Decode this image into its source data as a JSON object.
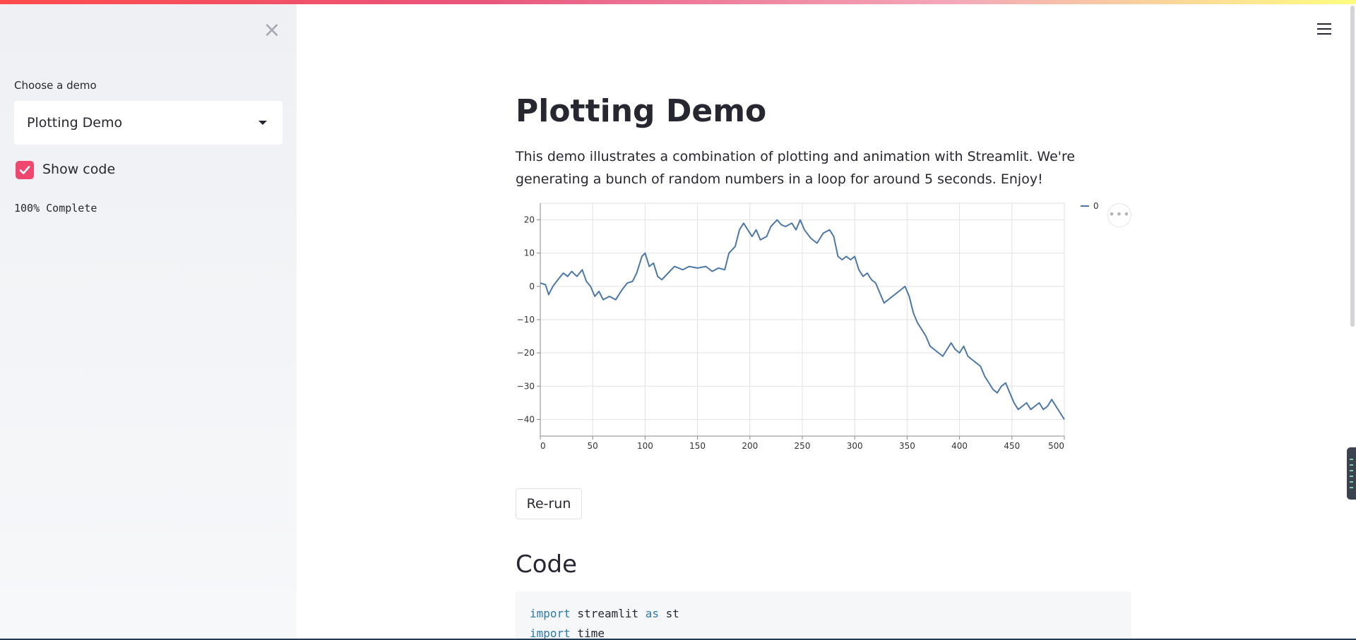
{
  "sidebar": {
    "close_symbol": "×",
    "select_label": "Choose a demo",
    "select_value": "Plotting Demo",
    "checkbox_label": "Show code",
    "checkbox_checked": true,
    "progress_text": "100% Complete",
    "progress_percent": 100,
    "checkbox_color": "#f0476e"
  },
  "header": {
    "menu_icon": "hamburger-menu-icon"
  },
  "main": {
    "title": "Plotting Demo",
    "description": "This demo illustrates a combination of plotting and animation with Streamlit. We're generating a bunch of random numbers in a loop for around 5 seconds. Enjoy!",
    "chart_menu_symbol": "•••",
    "rerun_label": "Re-run",
    "code_heading": "Code",
    "code_lines": [
      [
        {
          "t": "import",
          "kw": true
        },
        {
          "t": " streamlit ",
          "kw": false
        },
        {
          "t": "as",
          "kw": true
        },
        {
          "t": " st",
          "kw": false
        }
      ],
      [
        {
          "t": "import",
          "kw": true
        },
        {
          "t": " time",
          "kw": false
        }
      ]
    ]
  },
  "colors": {
    "accent": "#f0476e",
    "line": "#4c78a8",
    "keyword": "#2b7aa8"
  },
  "chart_data": {
    "type": "line",
    "xlim": [
      0,
      500
    ],
    "ylim": [
      -45,
      25
    ],
    "x_ticks": [
      0,
      50,
      100,
      150,
      200,
      250,
      300,
      350,
      400,
      450,
      500
    ],
    "y_ticks": [
      20,
      10,
      0,
      -10,
      -20,
      -30,
      -40
    ],
    "grid": true,
    "legend_position": "top-right",
    "series": [
      {
        "name": "0",
        "color": "#4c78a8",
        "points": [
          [
            0,
            1
          ],
          [
            5,
            0.5
          ],
          [
            8,
            -2.5
          ],
          [
            12,
            0
          ],
          [
            18,
            2.5
          ],
          [
            22,
            4
          ],
          [
            26,
            3
          ],
          [
            30,
            4.5
          ],
          [
            35,
            3
          ],
          [
            40,
            5
          ],
          [
            44,
            1.5
          ],
          [
            48,
            0
          ],
          [
            52,
            -3
          ],
          [
            56,
            -1.5
          ],
          [
            60,
            -4
          ],
          [
            66,
            -3
          ],
          [
            72,
            -4
          ],
          [
            78,
            -1
          ],
          [
            83,
            1
          ],
          [
            88,
            1.5
          ],
          [
            92,
            4
          ],
          [
            97,
            9
          ],
          [
            100,
            10
          ],
          [
            104,
            6
          ],
          [
            108,
            7
          ],
          [
            112,
            3
          ],
          [
            116,
            2
          ],
          [
            122,
            4
          ],
          [
            128,
            6
          ],
          [
            136,
            5
          ],
          [
            142,
            6
          ],
          [
            150,
            5.5
          ],
          [
            158,
            6
          ],
          [
            164,
            4.5
          ],
          [
            170,
            5.5
          ],
          [
            176,
            5
          ],
          [
            180,
            10
          ],
          [
            186,
            12
          ],
          [
            190,
            17
          ],
          [
            194,
            19
          ],
          [
            198,
            17
          ],
          [
            202,
            15
          ],
          [
            206,
            17
          ],
          [
            210,
            14
          ],
          [
            216,
            15
          ],
          [
            220,
            18
          ],
          [
            226,
            20
          ],
          [
            230,
            18.5
          ],
          [
            234,
            18
          ],
          [
            240,
            19
          ],
          [
            244,
            17
          ],
          [
            248,
            20
          ],
          [
            252,
            17
          ],
          [
            258,
            14.5
          ],
          [
            264,
            13
          ],
          [
            270,
            16
          ],
          [
            276,
            17
          ],
          [
            280,
            15
          ],
          [
            284,
            9
          ],
          [
            288,
            8
          ],
          [
            292,
            9
          ],
          [
            296,
            8
          ],
          [
            300,
            9
          ],
          [
            304,
            5
          ],
          [
            308,
            3
          ],
          [
            312,
            4
          ],
          [
            316,
            2
          ],
          [
            320,
            1
          ],
          [
            324,
            -2
          ],
          [
            328,
            -5
          ],
          [
            332,
            -4
          ],
          [
            336,
            -3
          ],
          [
            340,
            -2
          ],
          [
            344,
            -1
          ],
          [
            348,
            0
          ],
          [
            352,
            -3
          ],
          [
            356,
            -8
          ],
          [
            360,
            -11
          ],
          [
            364,
            -13
          ],
          [
            368,
            -15
          ],
          [
            372,
            -18
          ],
          [
            376,
            -19
          ],
          [
            380,
            -20
          ],
          [
            384,
            -21
          ],
          [
            388,
            -19
          ],
          [
            392,
            -17
          ],
          [
            396,
            -19
          ],
          [
            400,
            -20
          ],
          [
            404,
            -18
          ],
          [
            408,
            -21
          ],
          [
            412,
            -22
          ],
          [
            416,
            -23
          ],
          [
            420,
            -24
          ],
          [
            424,
            -27
          ],
          [
            428,
            -29
          ],
          [
            432,
            -31
          ],
          [
            436,
            -32
          ],
          [
            440,
            -30
          ],
          [
            444,
            -29
          ],
          [
            448,
            -32
          ],
          [
            452,
            -35
          ],
          [
            456,
            -37
          ],
          [
            460,
            -36
          ],
          [
            464,
            -35
          ],
          [
            468,
            -37
          ],
          [
            472,
            -36
          ],
          [
            476,
            -35
          ],
          [
            480,
            -37
          ],
          [
            484,
            -36
          ],
          [
            488,
            -34
          ],
          [
            492,
            -36
          ],
          [
            496,
            -38
          ],
          [
            500,
            -40
          ]
        ]
      }
    ]
  }
}
